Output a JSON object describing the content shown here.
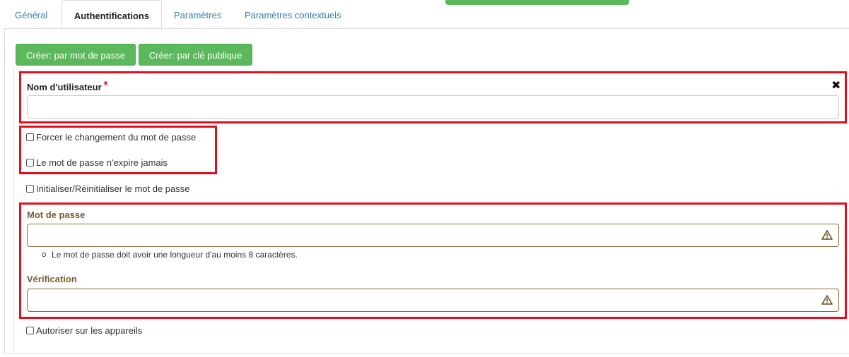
{
  "tabs": [
    {
      "label": "Général",
      "active": false
    },
    {
      "label": "Authentifications",
      "active": true
    },
    {
      "label": "Paramètres",
      "active": false
    },
    {
      "label": "Paramètres contextuels",
      "active": false
    }
  ],
  "buttons": {
    "create_password": "Créer: par mot de passe",
    "create_pubkey": "Créer: par clé publique"
  },
  "username": {
    "label": "Nom d'utilisateur",
    "required_marker": "*",
    "value": "",
    "remove_icon": "close-icon"
  },
  "checkboxes": {
    "force_change": {
      "label": "Forcer le changement du mot de passe",
      "checked": false
    },
    "never_expires": {
      "label": "Le mot de passe n'expire jamais",
      "checked": false
    },
    "init_reset": {
      "label": "Initialiser/Réinitialiser le mot de passe",
      "checked": false
    },
    "allow_devices": {
      "label": "Autoriser sur les appareils",
      "checked": false
    }
  },
  "password": {
    "label": "Mot de passe",
    "value": "",
    "hint": "Le mot de passe doit avoir une longueur d'au moins 8 caractères.",
    "status_icon": "warning-icon"
  },
  "verification": {
    "label": "Vérification",
    "value": "",
    "status_icon": "warning-icon"
  },
  "colors": {
    "button_green": "#5cb85c",
    "highlight_red": "#e0101e",
    "warning_brown": "#7a5c2e",
    "link_blue": "#337ab7"
  }
}
